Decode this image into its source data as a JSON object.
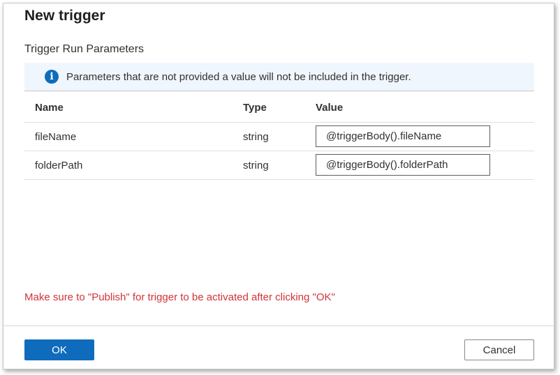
{
  "dialog": {
    "title": "New trigger",
    "section_title": "Trigger Run Parameters",
    "info": {
      "icon": "info-icon",
      "text": "Parameters that are not provided a value will not be included in the trigger."
    },
    "table": {
      "headers": {
        "name": "Name",
        "type": "Type",
        "value": "Value"
      },
      "rows": [
        {
          "name": "fileName",
          "type": "string",
          "value": "@triggerBody().fileName"
        },
        {
          "name": "folderPath",
          "type": "string",
          "value": "@triggerBody().folderPath"
        }
      ]
    },
    "warning": "Make sure to \"Publish\" for trigger to be activated after clicking \"OK\"",
    "buttons": {
      "ok": "OK",
      "cancel": "Cancel"
    }
  },
  "colors": {
    "accent": "#0f6cbd",
    "info_background": "#f0f6fd",
    "warning": "#d13438"
  }
}
